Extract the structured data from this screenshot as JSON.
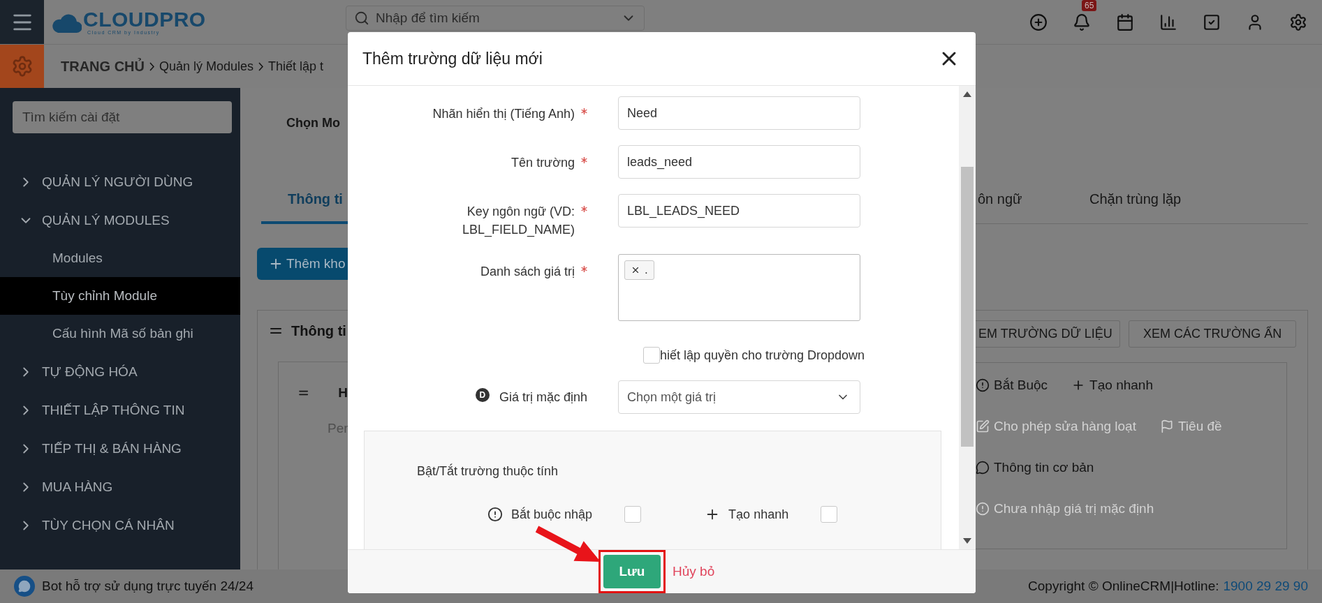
{
  "header": {
    "logo": "CLOUDPRO",
    "logo_tagline": "Cloud CRM by Industry",
    "search": {
      "placeholder": "Nhập để tìm kiếm"
    },
    "notification_count": "65"
  },
  "breadcrumb": [
    "TRANG CHỦ",
    "Quản lý Modules",
    "Thiết lập t"
  ],
  "sidebar": {
    "search": {
      "placeholder": "Tìm kiếm cài đặt"
    },
    "items": [
      {
        "label": "QUẢN LÝ NGƯỜI DÙNG",
        "expanded": false
      },
      {
        "label": "QUẢN LÝ MODULES",
        "expanded": true,
        "children": [
          {
            "label": "Modules",
            "selected": false
          },
          {
            "label": "Tùy chỉnh Module",
            "selected": true
          },
          {
            "label": "Cấu hình Mã số bản ghi",
            "selected": false
          }
        ]
      },
      {
        "label": "TỰ ĐỘNG HÓA",
        "expanded": false
      },
      {
        "label": "THIẾT LẬP THÔNG TIN",
        "expanded": false
      },
      {
        "label": "TIẾP THỊ & BÁN HÀNG",
        "expanded": false
      },
      {
        "label": "MUA HÀNG",
        "expanded": false
      },
      {
        "label": "TÙY CHỌN CÁ NHÂN",
        "expanded": false
      }
    ]
  },
  "page": {
    "module_label": "Chọn Mo",
    "tabs_left": [
      {
        "label": "Thông ti",
        "selected": true
      }
    ],
    "tabs_right": [
      {
        "label": "ôn ngữ",
        "selected": false
      },
      {
        "label": "Chặn trùng lặp",
        "selected": false
      }
    ],
    "add_button": "Thêm kho",
    "block": {
      "title": "Thông ti",
      "view_buttons": [
        "EM TRƯỜNG DỮ LIỆU",
        "XEM CÁC TRƯỜNG ẨN"
      ],
      "field_card": {
        "title": "H",
        "subtitle": "Per",
        "properties": [
          [
            {
              "kind": "required",
              "label": "Bắt Buộc",
              "disabled": false
            },
            {
              "kind": "quick_create",
              "label": "Tạo nhanh",
              "disabled": false
            }
          ],
          [
            {
              "kind": "mass_edit",
              "label": "Cho phép sửa hàng loạt",
              "disabled": true
            },
            {
              "kind": "header",
              "label": "Tiêu đề",
              "disabled": true
            }
          ],
          [
            {
              "kind": "block",
              "label": "Thông tin cơ bản",
              "disabled": false
            }
          ],
          [
            {
              "kind": "default",
              "label": "Chưa nhập giá trị mặc định",
              "disabled": true
            }
          ]
        ]
      }
    }
  },
  "dialog": {
    "title": "Thêm trường dữ liệu mới",
    "fields": [
      {
        "kind": "text",
        "label": "Nhãn hiển thị (Tiếng Anh)",
        "required": true,
        "value": "Need"
      },
      {
        "kind": "text",
        "label": "Tên trường",
        "required": true,
        "value": "leads_need"
      },
      {
        "kind": "text",
        "label": "Key ngôn ngữ (VD: LBL_FIELD_NAME)",
        "required": true,
        "value": "LBL_LEADS_NEED"
      },
      {
        "kind": "tags",
        "label": "Danh sách giá trị",
        "required": true,
        "tags": [
          "."
        ]
      },
      {
        "kind": "checkbox",
        "label": "hiết lập quyền cho trường Dropdown",
        "checked": false
      },
      {
        "kind": "select",
        "label": "Giá trị mặc định",
        "badge": "D",
        "placeholder": "Chọn một giá trị"
      }
    ],
    "attributes": {
      "title": "Bật/Tắt trường thuộc tính",
      "options": [
        {
          "kind": "required",
          "label": "Bắt buộc nhập",
          "checked": false
        },
        {
          "kind": "quick_create",
          "label": "Tạo nhanh",
          "checked": false
        }
      ]
    },
    "buttons": {
      "save": "Lưu",
      "save_highlighted": true,
      "cancel": "Hủy bỏ"
    }
  },
  "footer": {
    "bot": "Bot hỗ trợ sử dụng trực tuyến 24/24",
    "copyright": "Copyright © OnlineCRM|Hotline:",
    "hotline": "1900 29 29 90"
  }
}
